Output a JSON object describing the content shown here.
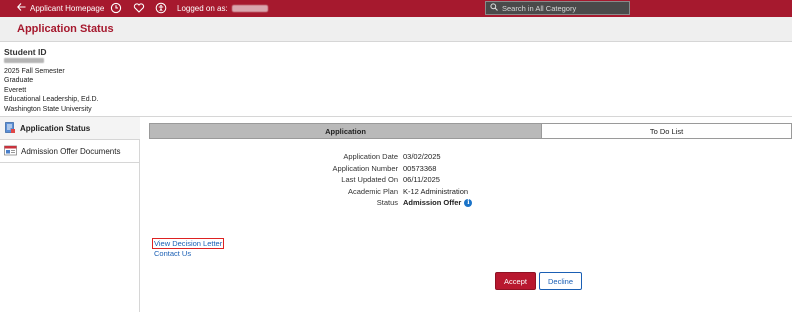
{
  "topbar": {
    "home_label": "Applicant Homepage",
    "logged_label": "Logged on as:",
    "search_placeholder": "Search in All Category",
    "bar_color": "#a6192e"
  },
  "page_title": "Application Status",
  "student": {
    "id_label": "Student ID",
    "lines": [
      "2025 Fall Semester",
      "Graduate",
      "Everett",
      "Educational Leadership, Ed.D.",
      "Washington State University"
    ]
  },
  "sidebar": {
    "items": [
      {
        "label": "Application Status",
        "icon": "clipboard-icon"
      },
      {
        "label": "Admission Offer Documents",
        "icon": "documents-icon"
      }
    ]
  },
  "tabs": {
    "application": "Application",
    "todo": "To Do List"
  },
  "details": [
    {
      "label": "Application Date",
      "value": "03/02/2025"
    },
    {
      "label": "Application Number",
      "value": "00573368"
    },
    {
      "label": "Last Updated On",
      "value": "06/11/2025"
    },
    {
      "label": "Academic Plan",
      "value": "K-12 Administration"
    },
    {
      "label": "Status",
      "value": "Admission Offer"
    }
  ],
  "links": {
    "decision_letter": "View Decision Letter",
    "contact_us": "Contact Us"
  },
  "buttons": {
    "accept": "Accept",
    "decline": "Decline"
  }
}
